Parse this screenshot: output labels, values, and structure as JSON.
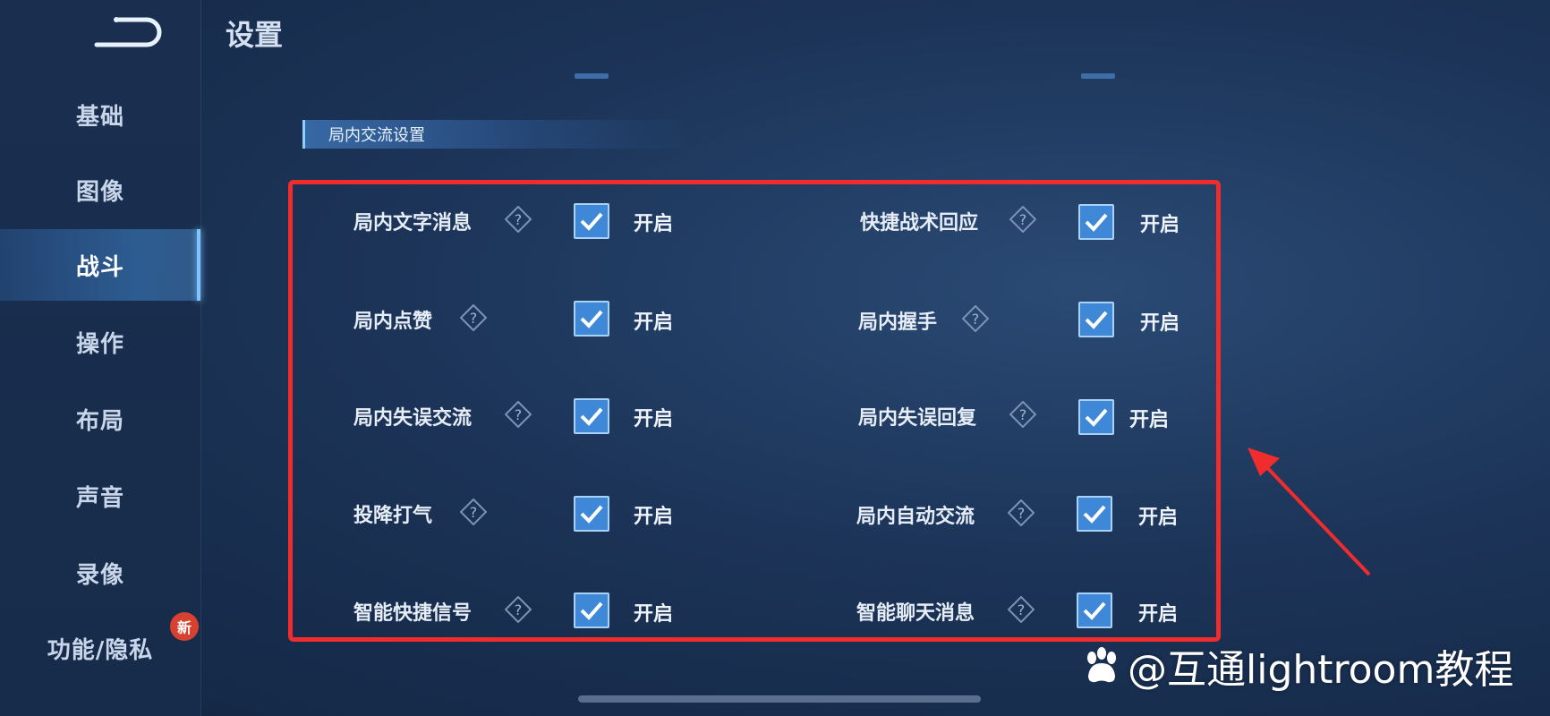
{
  "header": {
    "title": "设置"
  },
  "sidebar": {
    "items": [
      {
        "label": "基础",
        "active": false
      },
      {
        "label": "图像",
        "active": false
      },
      {
        "label": "战斗",
        "active": true
      },
      {
        "label": "操作",
        "active": false
      },
      {
        "label": "布局",
        "active": false
      },
      {
        "label": "声音",
        "active": false
      },
      {
        "label": "录像",
        "active": false
      },
      {
        "label": "功能/隐私",
        "active": false,
        "badge": "新"
      }
    ]
  },
  "section": {
    "title": "局内交流设置"
  },
  "settings": {
    "left": [
      {
        "label": "局内文字消息",
        "checked": true,
        "state": "开启"
      },
      {
        "label": "局内点赞",
        "checked": true,
        "state": "开启"
      },
      {
        "label": "局内失误交流",
        "checked": true,
        "state": "开启"
      },
      {
        "label": "投降打气",
        "checked": true,
        "state": "开启"
      },
      {
        "label": "智能快捷信号",
        "checked": true,
        "state": "开启"
      }
    ],
    "right": [
      {
        "label": "快捷战术回应",
        "checked": true,
        "state": "开启"
      },
      {
        "label": "局内握手",
        "checked": true,
        "state": "开启"
      },
      {
        "label": "局内失误回复",
        "checked": true,
        "state": "开启"
      },
      {
        "label": "局内自动交流",
        "checked": true,
        "state": "开启"
      },
      {
        "label": "智能聊天消息",
        "checked": true,
        "state": "开启"
      }
    ]
  },
  "watermark": {
    "text": "@互通lightroom教程"
  },
  "colors": {
    "accent": "#3f88d8",
    "highlight_frame": "#f02c2c",
    "background": "#1c3458"
  }
}
